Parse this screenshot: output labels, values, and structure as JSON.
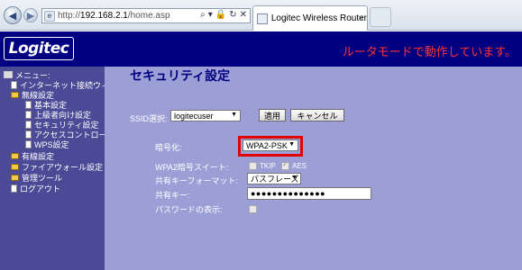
{
  "browser": {
    "address_prefix": "http://",
    "address_host": "192.168.2.1",
    "address_path": "/home.asp",
    "addr_tools": [
      "⌕",
      "▾",
      "🔒",
      "↻",
      "✕"
    ],
    "tab_title": "Logitec Wireless Router",
    "tab_close": "×"
  },
  "header": {
    "logo": "Logitec",
    "mode_message": "ルータモードで動作しています。",
    "bg_color": "#000080",
    "message_color": "#ff3333"
  },
  "sidebar": {
    "menu_title": "メニュー:",
    "items": [
      {
        "label": "インターネット接続ウィザード",
        "icon": "page-icon"
      },
      {
        "label": "無線設定",
        "icon": "folder-open-icon"
      },
      {
        "label": "基本設定",
        "icon": "document-icon"
      },
      {
        "label": "上級者向け設定",
        "icon": "document-icon"
      },
      {
        "label": "セキュリティ設定",
        "icon": "document-icon"
      },
      {
        "label": "アクセスコントロール",
        "icon": "document-icon"
      },
      {
        "label": "WPS設定",
        "icon": "document-icon"
      },
      {
        "label": "有線設定",
        "icon": "folder-icon"
      },
      {
        "label": "ファイアウォール設定",
        "icon": "folder-icon"
      },
      {
        "label": "管理ツール",
        "icon": "folder-icon"
      },
      {
        "label": "ログアウト",
        "icon": "document-icon"
      }
    ]
  },
  "main": {
    "title": "セキュリティ設定",
    "ssid_label": "SSID選択:",
    "ssid_value": "logitecuser",
    "apply_label": "適用",
    "cancel_label": "キャンセル",
    "encryption_label": "暗号化:",
    "encryption_value": "WPA2-PSK",
    "wpa2_suite_label": "WPA2暗号スイート:",
    "tkip_label": "TKIP",
    "aes_label": "AES",
    "tkip_checked": false,
    "aes_checked": true,
    "key_format_label": "共有キーフォーマット:",
    "key_format_value": "パスフレーズ",
    "shared_key_label": "共有キー:",
    "shared_key_value": "●●●●●●●●●●●●●●",
    "show_password_label": "パスワードの表示:",
    "bg_color": "#9b9fd6",
    "title_color": "#000080",
    "highlight_color": "#e00000"
  }
}
